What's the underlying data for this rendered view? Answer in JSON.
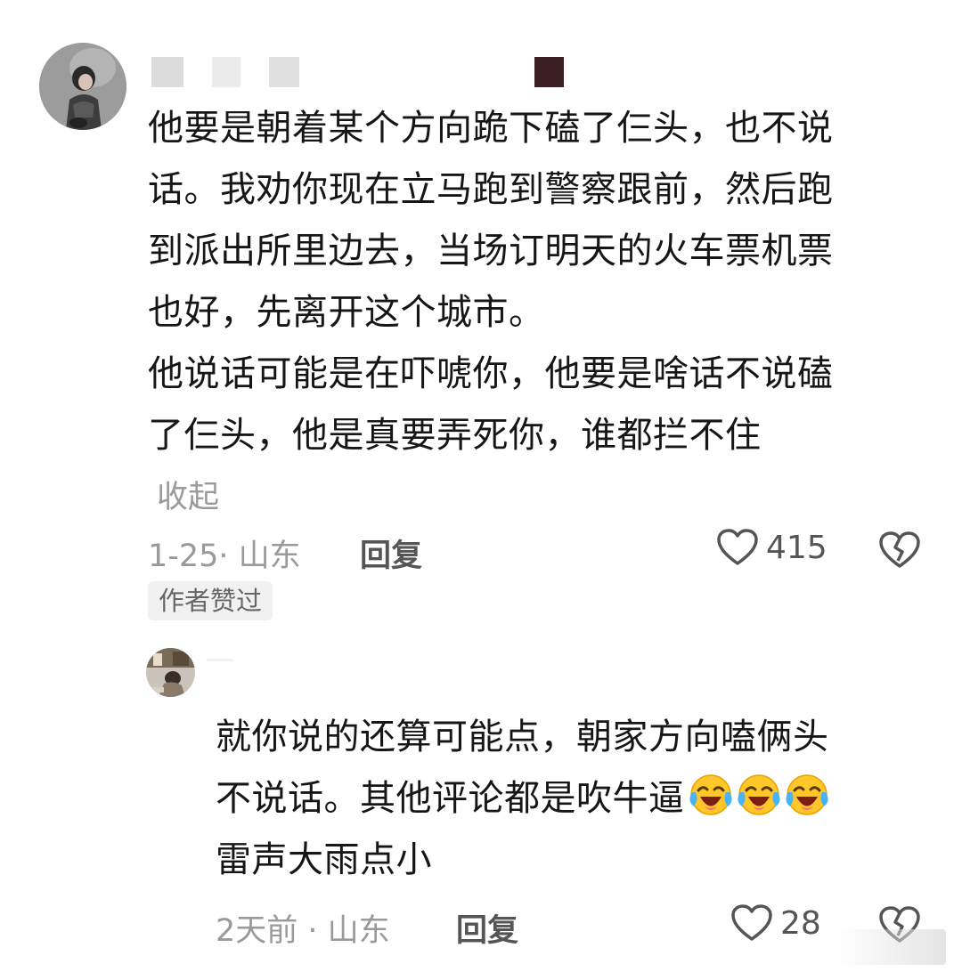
{
  "comment": {
    "lines": [
      "他要是朝着某个方向跪下磕了仨头，也不说",
      "话。我劝你现在立马跑到警察跟前，然后跑",
      "到派出所里边去，当场订明天的火车票机票",
      "也好，先离开这个城市。",
      "他说话可能是在吓唬你，他要是啥话不说磕",
      "了仨头，他是真要弄死你，谁都拦不住"
    ],
    "collapse_label": "收起",
    "meta": "1-25· 山东",
    "reply_label": "回复",
    "like_count": "415",
    "author_badge": "作者赞过",
    "name_colors": [
      "#dcdcdc",
      "#ebebeb",
      "#e0e0e0",
      "#3a1e24"
    ]
  },
  "reply": {
    "lines": [
      "就你说的还算可能点，朝家方向嗑俩头",
      "不说话。其他评论都是吹牛逼",
      "雷声大雨点小"
    ],
    "emoji_names": [
      "laughing-crying-emoji",
      "laughing-crying-emoji",
      "laughing-crying-emoji"
    ],
    "meta": "2天前 · 山东",
    "reply_label": "回复",
    "like_count": "28"
  },
  "icons": {
    "like": "heart-outline-icon",
    "dislike": "broken-heart-icon"
  }
}
